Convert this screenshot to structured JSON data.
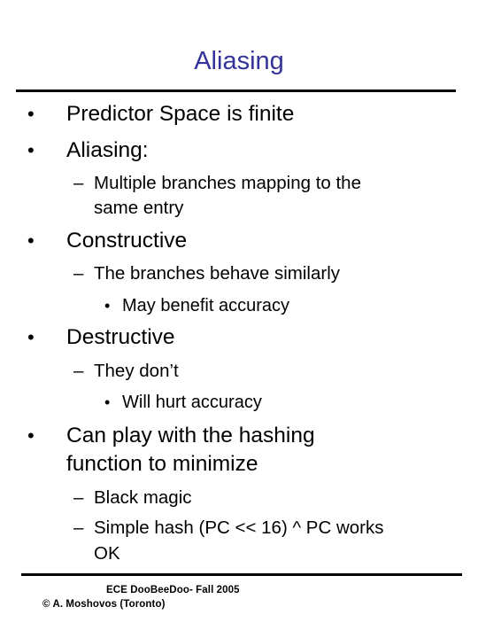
{
  "slide": {
    "title": "Aliasing",
    "title_color": "#333399",
    "bullets": {
      "b1": "Predictor Space is finite",
      "b2": "Aliasing:",
      "b2_sub1_line1": "Multiple branches mapping to the",
      "b2_sub1_line2": "same entry",
      "b3": "Constructive",
      "b3_sub1": "The branches behave similarly",
      "b3_sub1_sub1": "May benefit accuracy",
      "b4": "Destructive",
      "b4_sub1": "They don’t",
      "b4_sub1_sub1": "Will hurt accuracy",
      "b5_line1": "Can play with the hashing",
      "b5_line2": "function to minimize",
      "b5_sub1": "Black magic",
      "b5_sub2_line1": "Simple hash (PC << 16) ^ PC works",
      "b5_sub2_line2": "OK"
    },
    "glyphs": {
      "bullet": "•",
      "dash": "–"
    },
    "footer": {
      "course": "ECE DooBeeDoo- Fall 2005",
      "copyright": "© A. Moshovos (Toronto)"
    }
  }
}
